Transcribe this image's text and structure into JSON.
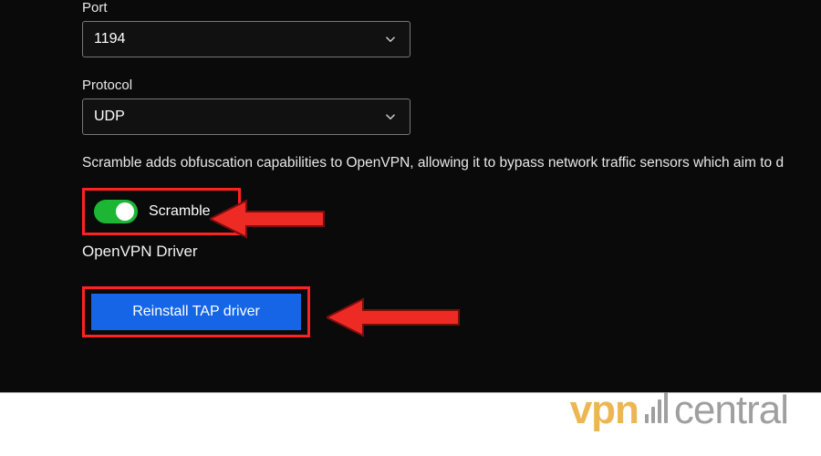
{
  "port": {
    "label": "Port",
    "value": "1194"
  },
  "protocol": {
    "label": "Protocol",
    "value": "UDP"
  },
  "scramble": {
    "description": "Scramble adds obfuscation capabilities to OpenVPN, allowing it to bypass network traffic sensors which aim to d",
    "label": "Scramble",
    "enabled": true
  },
  "driver": {
    "section_label": "OpenVPN Driver",
    "button_label": "Reinstall TAP driver"
  },
  "watermark": {
    "part1": "vpn",
    "part2": "central"
  },
  "colors": {
    "highlight": "#f22",
    "button": "#1565e6",
    "toggle_on": "#1db634"
  }
}
